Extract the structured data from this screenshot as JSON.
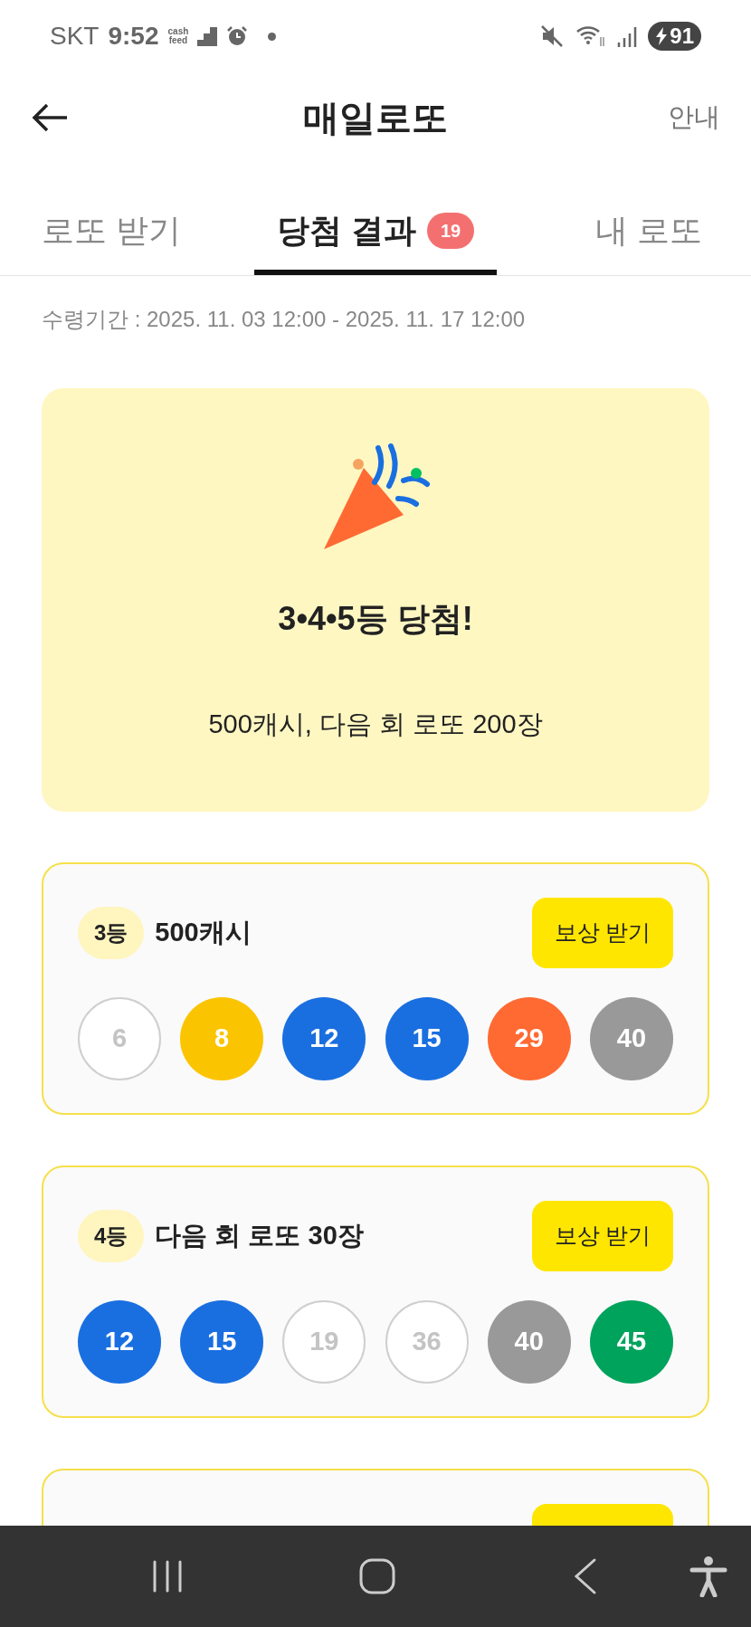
{
  "status_bar": {
    "carrier": "SKT",
    "time": "9:52",
    "app_badge": "cash\nfeed",
    "battery": "91"
  },
  "header": {
    "title": "매일로또",
    "action": "안내"
  },
  "tabs": [
    {
      "label": "로또 받기",
      "selected": false
    },
    {
      "label": "당첨 결과",
      "selected": true,
      "badge": "19"
    },
    {
      "label": "내 로또",
      "selected": false
    }
  ],
  "claim_period": "수령기간 : 2025. 11. 03 12:00 - 2025. 11. 17 12:00",
  "summary": {
    "title": "3•4•5등 당첨!",
    "detail": "500캐시, 다음 회 로또 200장"
  },
  "cards": [
    {
      "kind": "full",
      "rank": "3등",
      "prize": "500캐시",
      "button": "보상 받기",
      "balls": [
        {
          "number": "6",
          "kind": "outline"
        },
        {
          "number": "8",
          "kind": "filled",
          "color": "#fbc400"
        },
        {
          "number": "12",
          "kind": "filled",
          "color": "#1a6fe0"
        },
        {
          "number": "15",
          "kind": "filled",
          "color": "#1a6fe0"
        },
        {
          "number": "29",
          "kind": "filled",
          "color": "#ff6a33"
        },
        {
          "number": "40",
          "kind": "filled",
          "color": "#999999"
        }
      ]
    },
    {
      "kind": "full",
      "rank": "4등",
      "prize": "다음 회 로또 30장",
      "button": "보상 받기",
      "balls": [
        {
          "number": "12",
          "kind": "filled",
          "color": "#1a6fe0"
        },
        {
          "number": "15",
          "kind": "filled",
          "color": "#1a6fe0"
        },
        {
          "number": "19",
          "kind": "outline"
        },
        {
          "number": "36",
          "kind": "outline"
        },
        {
          "number": "40",
          "kind": "filled",
          "color": "#999999"
        },
        {
          "number": "45",
          "kind": "filled",
          "color": "#00a35c"
        }
      ]
    },
    {
      "kind": "cut"
    }
  ]
}
